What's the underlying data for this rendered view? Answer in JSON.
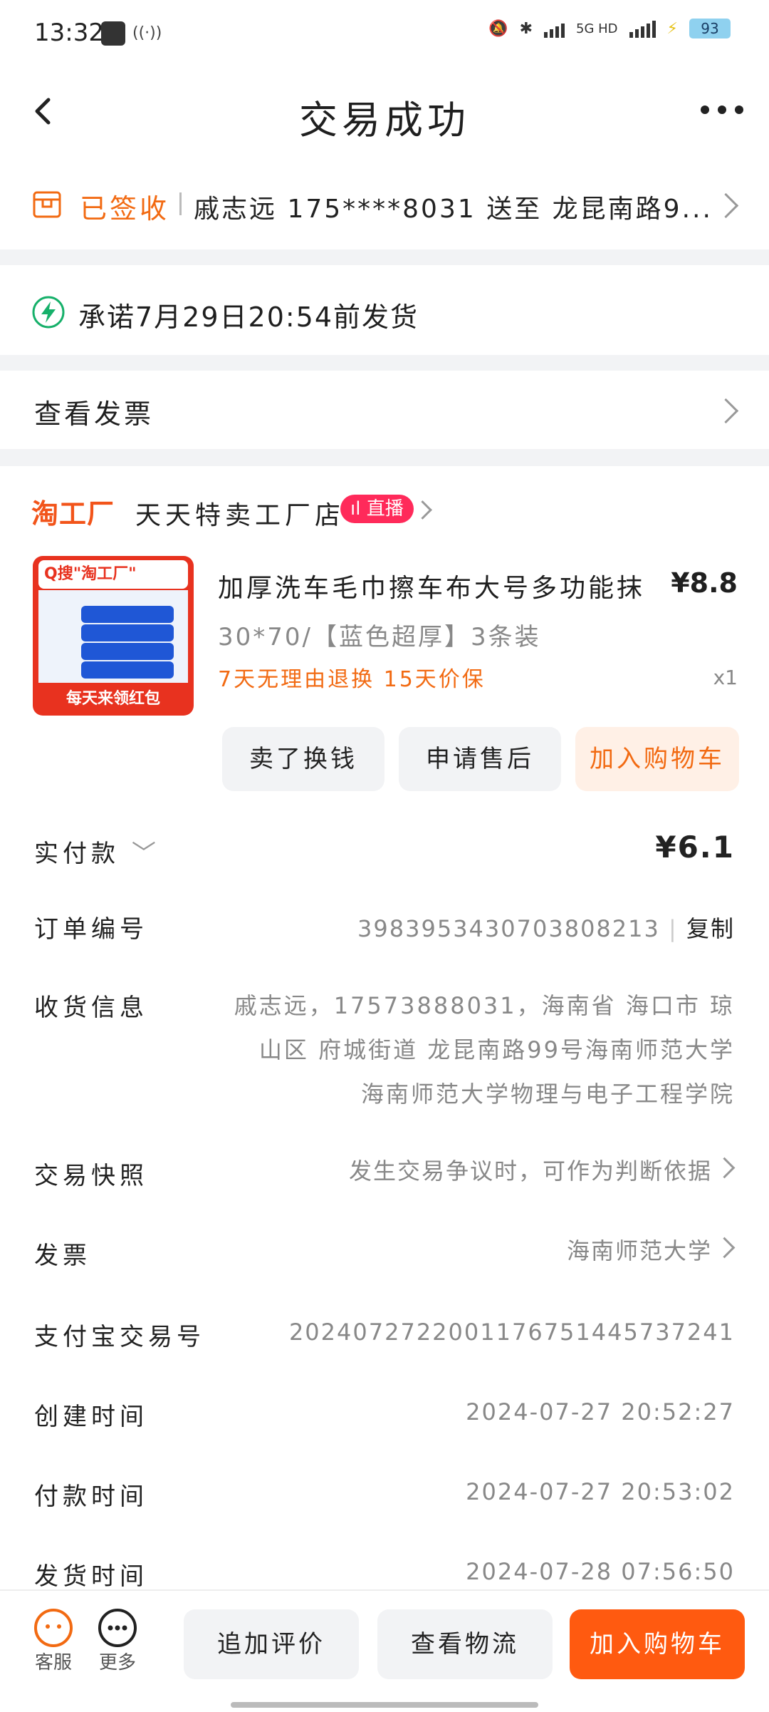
{
  "status_bar": {
    "time": "13:32",
    "signal": "5G HD",
    "battery": "93"
  },
  "header": {
    "title": "交易成功"
  },
  "delivery": {
    "status": "已签收",
    "text": "戚志远 175****8031 送至 龙昆南路9..."
  },
  "promise": {
    "text": "承诺7月29日20:54前发货"
  },
  "invoice_row": {
    "label": "查看发票"
  },
  "store": {
    "logo": "淘工厂",
    "name": "天天特卖工厂店",
    "live_badge": "直播"
  },
  "product": {
    "title": "加厚洗车毛巾擦车布大号多功能抹",
    "price": "¥8.8",
    "spec": "30*70/【蓝色超厚】3条装",
    "tags": "7天无理由退换 15天价保",
    "qty": "x1",
    "thumb_top": "Q搜\"淘工厂\"",
    "thumb_bottom": "每天来领红包"
  },
  "product_actions": {
    "sell": "卖了换钱",
    "after_sale": "申请售后",
    "add_cart": "加入购物车"
  },
  "details": {
    "paid": {
      "label": "实付款",
      "value": "¥6.1"
    },
    "order_no": {
      "label": "订单编号",
      "value": "3983953430703808213",
      "copy": "复制"
    },
    "receiver": {
      "label": "收货信息",
      "line1": "戚志远，17573888031，海南省 海口市 琼",
      "line2": "山区 府城街道 龙昆南路99号海南师范大学",
      "line3": "海南师范大学物理与电子工程学院"
    },
    "snapshot": {
      "label": "交易快照",
      "value": "发生交易争议时，可作为判断依据"
    },
    "invoice": {
      "label": "发票",
      "value": "海南师范大学"
    },
    "alipay_no": {
      "label": "支付宝交易号",
      "value": "2024072722001176751445737241"
    },
    "created": {
      "label": "创建时间",
      "value": "2024-07-27 20:52:27"
    },
    "paid_time": {
      "label": "付款时间",
      "value": "2024-07-27 20:53:02"
    },
    "shipped": {
      "label": "发货时间",
      "value": "2024-07-28 07:56:50"
    }
  },
  "bottom_bar": {
    "service": "客服",
    "more": "更多",
    "review": "追加评价",
    "logistics": "查看物流",
    "add_cart": "加入购物车"
  },
  "colors": {
    "accent": "#f26a12",
    "live": "#ff2a5a",
    "bg_sep": "#f2f3f5"
  }
}
